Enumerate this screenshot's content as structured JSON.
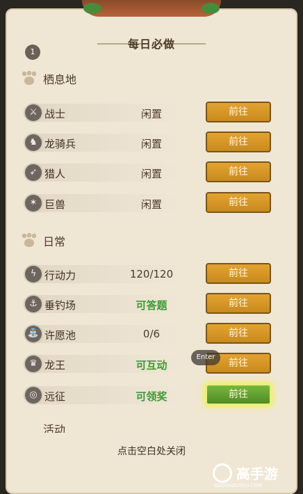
{
  "header": {
    "title": "每日必做",
    "badge": "1"
  },
  "sections": [
    {
      "label": "栖息地"
    },
    {
      "label": "日常"
    },
    {
      "label": "活动"
    }
  ],
  "habitat_rows": [
    {
      "name": "战士",
      "status": "闲置",
      "button": "前往"
    },
    {
      "name": "龙骑兵",
      "status": "闲置",
      "button": "前往"
    },
    {
      "name": "猎人",
      "status": "闲置",
      "button": "前往"
    },
    {
      "name": "巨兽",
      "status": "闲置",
      "button": "前往"
    }
  ],
  "daily_rows": [
    {
      "name": "行动力",
      "status": "120/120",
      "button": "前往"
    },
    {
      "name": "垂钓场",
      "status": "可答题",
      "button": "前往"
    },
    {
      "name": "许愿池",
      "status": "0/6",
      "button": "前往"
    },
    {
      "name": "龙王",
      "status": "可互动",
      "button": "前往"
    },
    {
      "name": "远征",
      "status": "可领奖",
      "button": "前往"
    }
  ],
  "tooltip": "Enter",
  "close_hint": "点击空白处关闭",
  "watermark": {
    "text": "高手游",
    "url": "GAOSHOUYOU.COM"
  },
  "colors": {
    "button": "#d79a28",
    "highlight": "#5e9e2f",
    "status_green": "#3d9a36"
  }
}
